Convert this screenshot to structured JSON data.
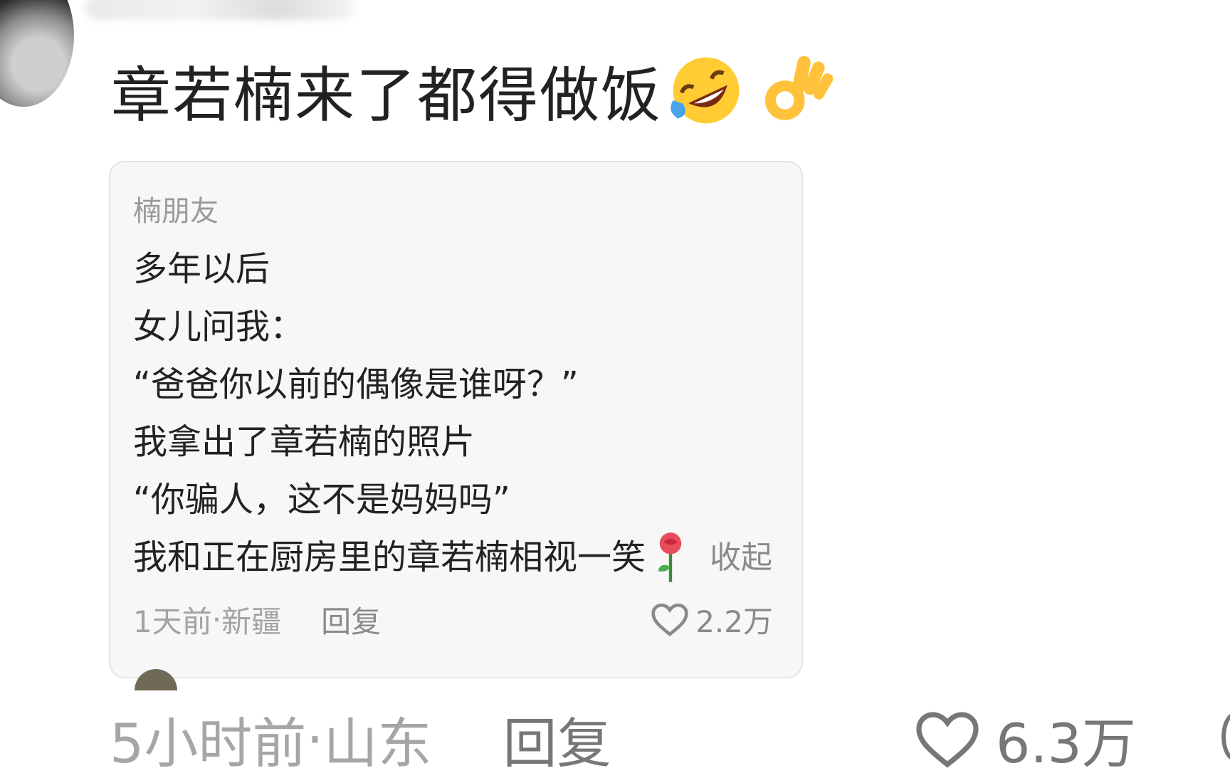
{
  "comment": {
    "text": "章若楠来了都得做饭",
    "emojis": [
      "rolling-on-floor-laughing-emoji",
      "ok-hand-emoji"
    ]
  },
  "quote": {
    "author": "楠朋友",
    "lines": [
      "多年以后",
      "女儿问我：",
      "“爸爸你以前的偶像是谁呀？”",
      "我拿出了章若楠的照片",
      "“你骗人，这不是妈妈吗”",
      "我和正在厨房里的章若楠相视一笑"
    ],
    "trailing_emoji": "rose-emoji",
    "collapse_label": "收起",
    "time": "1天前",
    "separator": " · ",
    "location": "新疆",
    "reply_label": "回复",
    "like_count": "2.2万"
  },
  "footer": {
    "time": "5小时前",
    "separator": " · ",
    "location": "山东",
    "reply_label": "回复",
    "like_count": "6.3万"
  }
}
